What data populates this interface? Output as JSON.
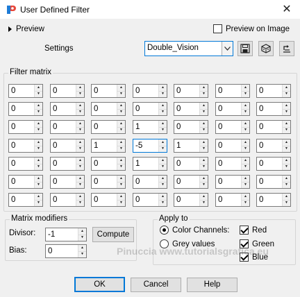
{
  "window": {
    "title": "User Defined Filter",
    "close": "✕"
  },
  "preview": {
    "label": "Preview",
    "preview_on_image": "Preview on Image",
    "preview_on_image_checked": false
  },
  "settings": {
    "label": "Settings",
    "preset": "Double_Vision"
  },
  "filter_matrix": {
    "title": "Filter matrix",
    "rows": [
      [
        "0",
        "0",
        "0",
        "0",
        "0",
        "0",
        "0"
      ],
      [
        "0",
        "0",
        "0",
        "0",
        "0",
        "0",
        "0"
      ],
      [
        "0",
        "0",
        "0",
        "1",
        "0",
        "0",
        "0"
      ],
      [
        "0",
        "0",
        "1",
        "-5",
        "1",
        "0",
        "0"
      ],
      [
        "0",
        "0",
        "0",
        "1",
        "0",
        "0",
        "0"
      ],
      [
        "0",
        "0",
        "0",
        "0",
        "0",
        "0",
        "0"
      ],
      [
        "0",
        "0",
        "0",
        "0",
        "0",
        "0",
        "0"
      ]
    ]
  },
  "modifiers": {
    "title": "Matrix modifiers",
    "divisor_label": "Divisor:",
    "divisor": "-1",
    "bias_label": "Bias:",
    "bias": "0",
    "compute": "Compute"
  },
  "apply_to": {
    "title": "Apply to",
    "color_channels": "Color Channels:",
    "grey_values": "Grey values",
    "selected": "color",
    "red": "Red",
    "green": "Green",
    "blue": "Blue",
    "red_checked": true,
    "green_checked": true,
    "blue_checked": true
  },
  "buttons": {
    "ok": "OK",
    "cancel": "Cancel",
    "help": "Help"
  },
  "watermark": "Pinuccia  www.tutorialsgrafica.eu",
  "colors": {
    "focus_blue": "#0078d7",
    "dialog_bg": "#f0f0f0"
  }
}
